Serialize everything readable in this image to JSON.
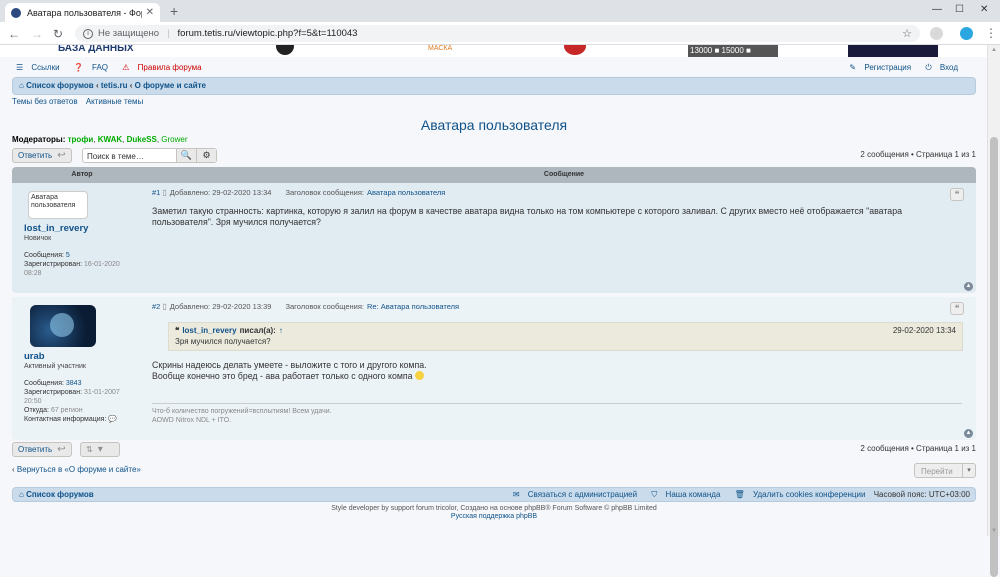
{
  "browser": {
    "tab_title": "Аватара пользователя - Форум",
    "tab_close": "✕",
    "new_tab": "+",
    "not_secure": "Не защищено",
    "url": "forum.tetis.ru/viewtopic.php?f=5&t=110043"
  },
  "banner": {
    "text1": "БАЗА ДАННЫХ",
    "text2": "МАСКА",
    "text3": "13000 ■ 15000 ■"
  },
  "top_links": {
    "links": "Ссылки",
    "faq": "FAQ",
    "rules": "Правила форума",
    "register": "Регистрация",
    "login": "Вход"
  },
  "breadcrumb": {
    "home": "Список форумов",
    "forum1": "tetis.ru",
    "forum2": "О форуме и сайте"
  },
  "subnav": {
    "unanswered": "Темы без ответов",
    "active": "Активные темы"
  },
  "topic_title": "Аватара пользователя",
  "moderators": {
    "label": "Модераторы:",
    "m1": "трофи",
    "m2": "KWAK",
    "m3": "DukeSS",
    "m4": "Grower"
  },
  "actions": {
    "reply": "Ответить",
    "search_placeholder": "Поиск в теме…",
    "pagination": "2 сообщения • Страница 1 из 1"
  },
  "table": {
    "col_author": "Автор",
    "col_message": "Сообщение"
  },
  "posts": [
    {
      "avatar_alt": "Аватара пользователя",
      "username": "lost_in_revery",
      "rank": "Новичок",
      "messages_label": "Сообщения:",
      "messages": "5",
      "registered_label": "Зарегистрирован:",
      "registered": "16-01-2020 08:28",
      "num": "#1",
      "added_label": "Добавлено:",
      "date": "29-02-2020 13:34",
      "subject_label": "Заголовок сообщения:",
      "subject": "Аватара пользователя",
      "text": "Заметил такую странность: картинка, которую я залил на форум в качестве аватара видна только на том компьютере с которого заливал. С других вместо неё отображается \"аватара пользователя\". Зря мучился получается?"
    },
    {
      "username": "urab",
      "rank": "Активный участник",
      "messages_label": "Сообщения:",
      "messages": "3843",
      "registered_label": "Зарегистрирован:",
      "registered": "31-01-2007 20:50",
      "from_label": "Откуда:",
      "from": "67 регион",
      "contact_label": "Контактная информация:",
      "num": "#2",
      "added_label": "Добавлено:",
      "date": "29-02-2020 13:39",
      "subject_label": "Заголовок сообщения:",
      "subject": "Re: Аватара пользователя",
      "quote_author": "lost_in_revery",
      "quote_wrote": "писал(а):",
      "quote_date": "29-02-2020 13:34",
      "quote_text": "Зря мучился получается?",
      "text1": "Скрины надеюсь делать умеете - выложите с того и другого компа.",
      "text2": "Вообще конечно это бред - ава работает только с одного компа",
      "sig1": "Что-б количество погружений=всплытиям! Всем удачи.",
      "sig2": "AOWD Nitrox NDL + ITO."
    }
  ],
  "bottom": {
    "return_link": "Вернуться в «О форуме и сайте»",
    "goto": "Перейти"
  },
  "footer": {
    "home": "Список форумов",
    "contact": "Связаться с администрацией",
    "team": "Наша команда",
    "cookies": "Удалить cookies конференции",
    "tz": "Часовой пояс: UTC+03:00",
    "copy1": "Style developer by support forum tricolor, Создано на основе phpBB® Forum Software © phpBB Limited",
    "copy2": "Русская поддержка phpBB"
  }
}
